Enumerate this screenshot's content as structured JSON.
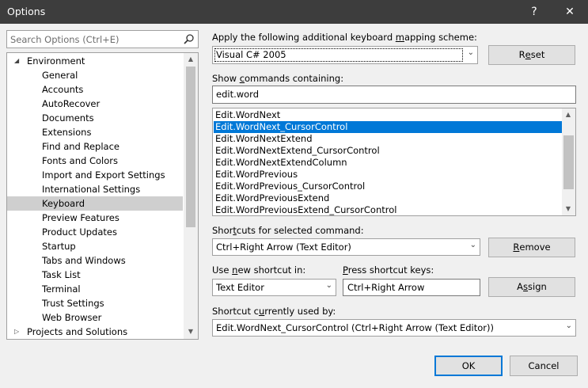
{
  "window": {
    "title": "Options",
    "help_glyph": "?",
    "close_glyph": "✕"
  },
  "search": {
    "placeholder": "Search Options (Ctrl+E)"
  },
  "tree": {
    "items": [
      {
        "label": "Environment",
        "level": 0,
        "expanded": true
      },
      {
        "label": "General",
        "level": 1
      },
      {
        "label": "Accounts",
        "level": 1
      },
      {
        "label": "AutoRecover",
        "level": 1
      },
      {
        "label": "Documents",
        "level": 1
      },
      {
        "label": "Extensions",
        "level": 1
      },
      {
        "label": "Find and Replace",
        "level": 1
      },
      {
        "label": "Fonts and Colors",
        "level": 1
      },
      {
        "label": "Import and Export Settings",
        "level": 1
      },
      {
        "label": "International Settings",
        "level": 1
      },
      {
        "label": "Keyboard",
        "level": 1,
        "selected": true
      },
      {
        "label": "Preview Features",
        "level": 1
      },
      {
        "label": "Product Updates",
        "level": 1
      },
      {
        "label": "Startup",
        "level": 1
      },
      {
        "label": "Tabs and Windows",
        "level": 1
      },
      {
        "label": "Task List",
        "level": 1
      },
      {
        "label": "Terminal",
        "level": 1
      },
      {
        "label": "Trust Settings",
        "level": 1
      },
      {
        "label": "Web Browser",
        "level": 1
      },
      {
        "label": "Projects and Solutions",
        "level": 0,
        "expanded": false
      }
    ]
  },
  "mapping": {
    "label_pre": "Apply the following additional keyboard ",
    "label_ul": "m",
    "label_post": "apping scheme:",
    "value": "Visual C# 2005",
    "reset_pre": "R",
    "reset_ul": "e",
    "reset_post": "set"
  },
  "show_commands": {
    "label_pre": "Show ",
    "label_ul": "c",
    "label_post": "ommands containing:",
    "value": "edit.word"
  },
  "commands": {
    "items": [
      "Edit.WordNext",
      "Edit.WordNext_CursorControl",
      "Edit.WordNextExtend",
      "Edit.WordNextExtend_CursorControl",
      "Edit.WordNextExtendColumn",
      "Edit.WordPrevious",
      "Edit.WordPrevious_CursorControl",
      "Edit.WordPreviousExtend",
      "Edit.WordPreviousExtend_CursorControl"
    ],
    "selected_index": 1
  },
  "shortcuts": {
    "label_pre": "Shor",
    "label_ul": "t",
    "label_post": "cuts for selected command:",
    "value": "Ctrl+Right Arrow (Text Editor)",
    "remove_pre": "",
    "remove_ul": "R",
    "remove_post": "emove"
  },
  "new_shortcut": {
    "label_pre": "Use ",
    "label_ul": "n",
    "label_post": "ew shortcut in:",
    "value": "Text Editor"
  },
  "press_keys": {
    "label_pre": "",
    "label_ul": "P",
    "label_post": "ress shortcut keys:",
    "value": "Ctrl+Right Arrow",
    "assign_pre": "A",
    "assign_ul": "s",
    "assign_post": "sign"
  },
  "used_by": {
    "label_pre": "Shortcut c",
    "label_ul": "u",
    "label_post": "rrently used by:",
    "value": "Edit.WordNext_CursorControl (Ctrl+Right Arrow (Text Editor))"
  },
  "footer": {
    "ok": "OK",
    "cancel": "Cancel"
  },
  "colors": {
    "titlebar": "#3d3d3d",
    "selection": "#0078d7",
    "tree_selection": "#cfcfcf"
  }
}
